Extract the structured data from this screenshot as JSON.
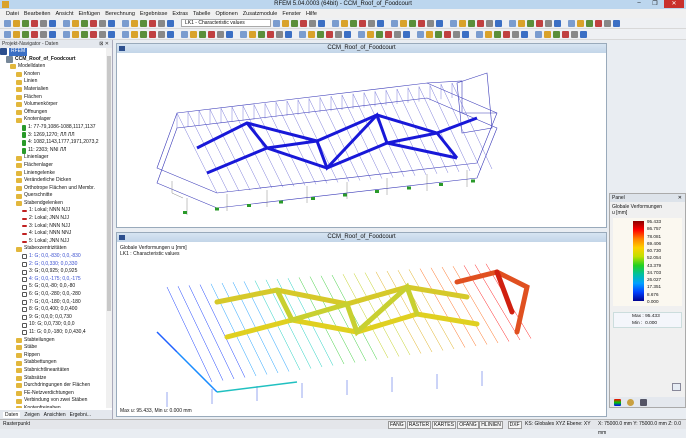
{
  "window": {
    "title": "RFEM 5.04.0003 (64bit) - CCM_Roof_of_Foodcourt"
  },
  "menu": [
    "Datei",
    "Bearbeiten",
    "Ansicht",
    "Einfügen",
    "Berechnung",
    "Ergebnisse",
    "Extras",
    "Tabelle",
    "Optionen",
    "Zusatzmodule",
    "Fenster",
    "Hilfe"
  ],
  "toolbar": {
    "loadcase": "LK1 - Characteristic values"
  },
  "navigator": {
    "title": "Projekt-Navigator - Daten",
    "root": "RFEM",
    "project": "CCM_Roof_of_Foodcourt",
    "items": [
      {
        "t": "Modelldaten",
        "l": 1,
        "f": 1
      },
      {
        "t": "Knoten",
        "l": 2,
        "f": 1
      },
      {
        "t": "Linien",
        "l": 2,
        "f": 1
      },
      {
        "t": "Materialien",
        "l": 2,
        "f": 1
      },
      {
        "t": "Flächen",
        "l": 2,
        "f": 1
      },
      {
        "t": "Volumenkörper",
        "l": 2,
        "f": 1
      },
      {
        "t": "Öffnungen",
        "l": 2,
        "f": 1
      },
      {
        "t": "Knotenlager",
        "l": 2,
        "f": 1
      },
      {
        "t": "1: 77-79,1086-1088,1117,1137",
        "l": 3,
        "s": 1
      },
      {
        "t": "3: 1269,1270; ЛЛ ЛЛ",
        "l": 3,
        "s": 1
      },
      {
        "t": "4: 1082,1143,1777,1971,2073,2",
        "l": 3,
        "s": 1
      },
      {
        "t": "11: 2303; NNI ЛЛ",
        "l": 3,
        "s": 1
      },
      {
        "t": "Linienlager",
        "l": 2,
        "f": 1
      },
      {
        "t": "Flächenlager",
        "l": 2,
        "f": 1
      },
      {
        "t": "Liniengelenke",
        "l": 2,
        "f": 1
      },
      {
        "t": "Veränderliche Dicken",
        "l": 2,
        "f": 1
      },
      {
        "t": "Orthotrope Flächen und Membr.",
        "l": 2,
        "f": 1
      },
      {
        "t": "Querschnitte",
        "l": 2,
        "f": 1
      },
      {
        "t": "Stabendgelenken",
        "l": 2,
        "f": 1
      },
      {
        "t": "1: Lokal; NNN NJJ",
        "l": 3,
        "h": 1
      },
      {
        "t": "2: Lokal; JNN NJJ",
        "l": 3,
        "h": 1
      },
      {
        "t": "3: Lokal; NNN NJJ",
        "l": 3,
        "h": 1
      },
      {
        "t": "4: Lokal; NNN NNJ",
        "l": 3,
        "h": 1
      },
      {
        "t": "5: Lokal; JNN NJJ",
        "l": 3,
        "h": 1
      },
      {
        "t": "Stabexzentrizitäten",
        "l": 2,
        "f": 1
      },
      {
        "t": "1: G; 0,0,-830; 0,0,-830",
        "l": 3,
        "e": 1,
        "b": 1
      },
      {
        "t": "2: G; 0,0,330; 0,0,330",
        "l": 3,
        "e": 1,
        "b": 1
      },
      {
        "t": "3: G; 0,0,925; 0,0,925",
        "l": 3,
        "e": 1
      },
      {
        "t": "4: G; 0,0,-175; 0,0,-175",
        "l": 3,
        "e": 1,
        "b": 1
      },
      {
        "t": "5: G; 0,0,-80; 0,0,-80",
        "l": 3,
        "e": 1
      },
      {
        "t": "6: G; 0,0,-280; 0,0,-280",
        "l": 3,
        "e": 1
      },
      {
        "t": "7: G; 0,0,-180; 0,0,-180",
        "l": 3,
        "e": 1
      },
      {
        "t": "8: G; 0,0,400; 0,0,400",
        "l": 3,
        "e": 1
      },
      {
        "t": "9: G; 0,0,0; 0,0,730",
        "l": 3,
        "e": 1
      },
      {
        "t": "10: G; 0,0,730; 0,0,0",
        "l": 3,
        "e": 1
      },
      {
        "t": "11: G; 0,0,-180; 0,0,430,4",
        "l": 3,
        "e": 1
      },
      {
        "t": "Stabteilungen",
        "l": 2,
        "f": 1
      },
      {
        "t": "Stäbe",
        "l": 2,
        "f": 1
      },
      {
        "t": "Rippen",
        "l": 2,
        "f": 1
      },
      {
        "t": "Stabbettungen",
        "l": 2,
        "f": 1
      },
      {
        "t": "Stabnichtlinearitäten",
        "l": 2,
        "f": 1
      },
      {
        "t": "Stabsätze",
        "l": 2,
        "f": 1
      },
      {
        "t": "Durchdringungen der Flächen",
        "l": 2,
        "f": 1
      },
      {
        "t": "FE-Netzverdichtungen",
        "l": 2,
        "f": 1
      },
      {
        "t": "Verbindung von zwei Stäben",
        "l": 2,
        "f": 1
      },
      {
        "t": "Knotenfreigaben",
        "l": 2,
        "f": 1
      }
    ],
    "tabs": [
      "Daten",
      "Zeigen",
      "Ansichten",
      "Ergebni..."
    ]
  },
  "views": {
    "top": {
      "title": "CCM_Roof_of_Foodcourt"
    },
    "bottom": {
      "title": "CCM_Roof_of_Foodcourt",
      "line1": "Globale Verformungen u [mm]",
      "line2": "LK1 : Characteristic values",
      "footer": "Max u: 95.433, Min u: 0.000 mm"
    }
  },
  "panel": {
    "title": "Panel",
    "label1": "Globale Verformungen",
    "label2": "u [mm]",
    "scale": [
      "95.433",
      "86.757",
      "78.081",
      "69.406",
      "60.730",
      "52.054",
      "43.379",
      "34.703",
      "26.027",
      "17.351",
      "8.676",
      "0.000"
    ],
    "max_label": "Max :",
    "max": "95.433",
    "min_label": "Min :",
    "min": "0.000"
  },
  "status": {
    "left": "Rasterpunkt",
    "buttons": [
      "FANG",
      "RASTER",
      "KARTES",
      "OFANG",
      "HLINIEN",
      "DXF"
    ],
    "ks": "KS: Globales XYZ Ebene: XY",
    "coords": "X: 75000.0 mm  Y: 75000.0 mm  Z: 0.0 mm"
  }
}
